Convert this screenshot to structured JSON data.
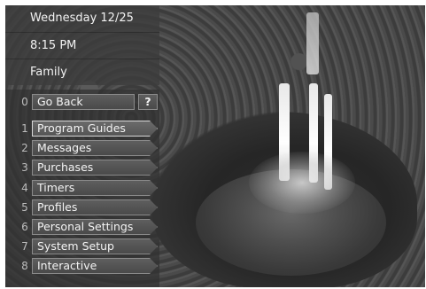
{
  "header": {
    "date": "Wednesday 12/25",
    "time": "8:15 PM",
    "profile": "Family"
  },
  "back": {
    "number": "0",
    "label": "Go Back",
    "help_label": "?"
  },
  "menu": {
    "items": [
      {
        "number": "1",
        "label": "Program Guides"
      },
      {
        "number": "2",
        "label": "Messages"
      },
      {
        "number": "3",
        "label": "Purchases"
      },
      {
        "number": "4",
        "label": "Timers"
      },
      {
        "number": "5",
        "label": "Profiles"
      },
      {
        "number": "6",
        "label": "Personal Settings"
      },
      {
        "number": "7",
        "label": "System Setup"
      },
      {
        "number": "8",
        "label": "Interactive"
      }
    ],
    "selected_index": 0
  }
}
